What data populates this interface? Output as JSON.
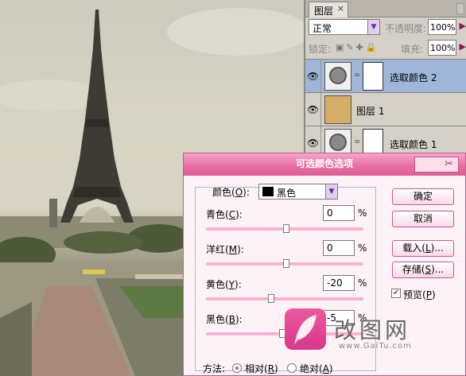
{
  "layers_panel": {
    "tab_label": "图层",
    "tab_close": "×",
    "blend_mode": "正常",
    "opacity_label": "不透明度:",
    "opacity_value": "100%",
    "lock_label": "锁定:",
    "fill_label": "填充:",
    "fill_value": "100%",
    "layers": [
      {
        "name": "选取颜色 2",
        "selected": true
      },
      {
        "name": "图层 1",
        "selected": false
      },
      {
        "name": "选取颜色 1",
        "selected": false
      }
    ]
  },
  "dialog": {
    "title": "可选颜色选项",
    "color_label": "颜色",
    "color_key": "O",
    "color_value": "黑色",
    "cyan_label": "青色",
    "cyan_key": "C",
    "cyan_value": "0",
    "magenta_label": "洋红",
    "magenta_key": "M",
    "magenta_value": "0",
    "yellow_label": "黄色",
    "yellow_key": "Y",
    "yellow_value": "-20",
    "black_label": "黑色",
    "black_key": "B",
    "black_value": "-5",
    "percent": "%",
    "ok_label": "确定",
    "cancel_label": "取消",
    "load_label": "载入",
    "load_key": "L",
    "save_label": "存储",
    "save_key": "S",
    "preview_label": "预览",
    "preview_key": "P",
    "method_label": "方法:",
    "relative_label": "相对",
    "relative_key": "R",
    "absolute_label": "绝对",
    "absolute_key": "A",
    "ellipsis": "..."
  },
  "watermark": {
    "text": "改图网",
    "sub": "www.GaiTu.com"
  },
  "colors": {
    "accent": "#e86fa5",
    "track": "#f7b3d1",
    "selected_layer": "#9fb6d8",
    "layer1_fill": "#d5ad66"
  }
}
